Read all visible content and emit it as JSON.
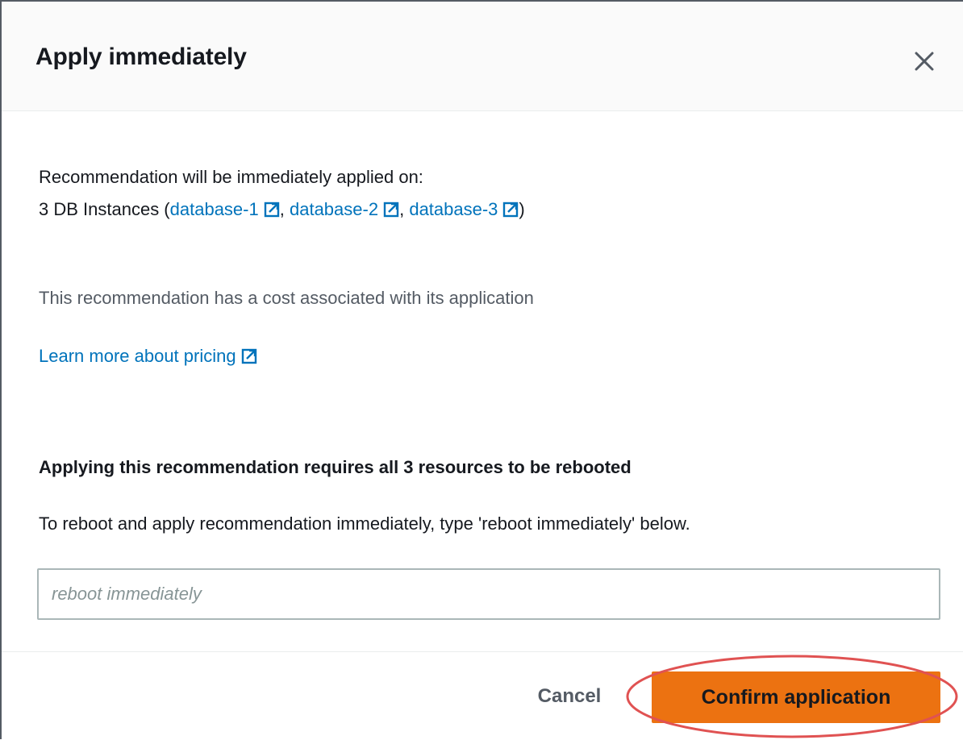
{
  "dialog": {
    "title": "Apply immediately",
    "close_icon": "close-icon"
  },
  "content": {
    "line1": "Recommendation will be immediately applied on:",
    "instances_prefix": "3 DB Instances (",
    "instances": [
      {
        "label": "database-1"
      },
      {
        "label": "database-2"
      },
      {
        "label": "database-3"
      }
    ],
    "separator": ",",
    "instances_suffix": ")",
    "cost_note": "This recommendation has a cost associated with its application",
    "pricing_link": "Learn more about pricing",
    "reboot_heading": "Applying this recommendation requires all 3 resources to be rebooted",
    "reboot_instruction": "To reboot and apply recommendation immediately, type 'reboot immediately' below."
  },
  "input": {
    "value": "",
    "placeholder": "reboot immediately"
  },
  "footer": {
    "cancel_label": "Cancel",
    "confirm_label": "Confirm application"
  },
  "colors": {
    "link": "#0073bb",
    "primary_button": "#ec7211",
    "highlight_ring": "#e05252",
    "text": "#16191f",
    "secondary_text": "#545b64"
  }
}
